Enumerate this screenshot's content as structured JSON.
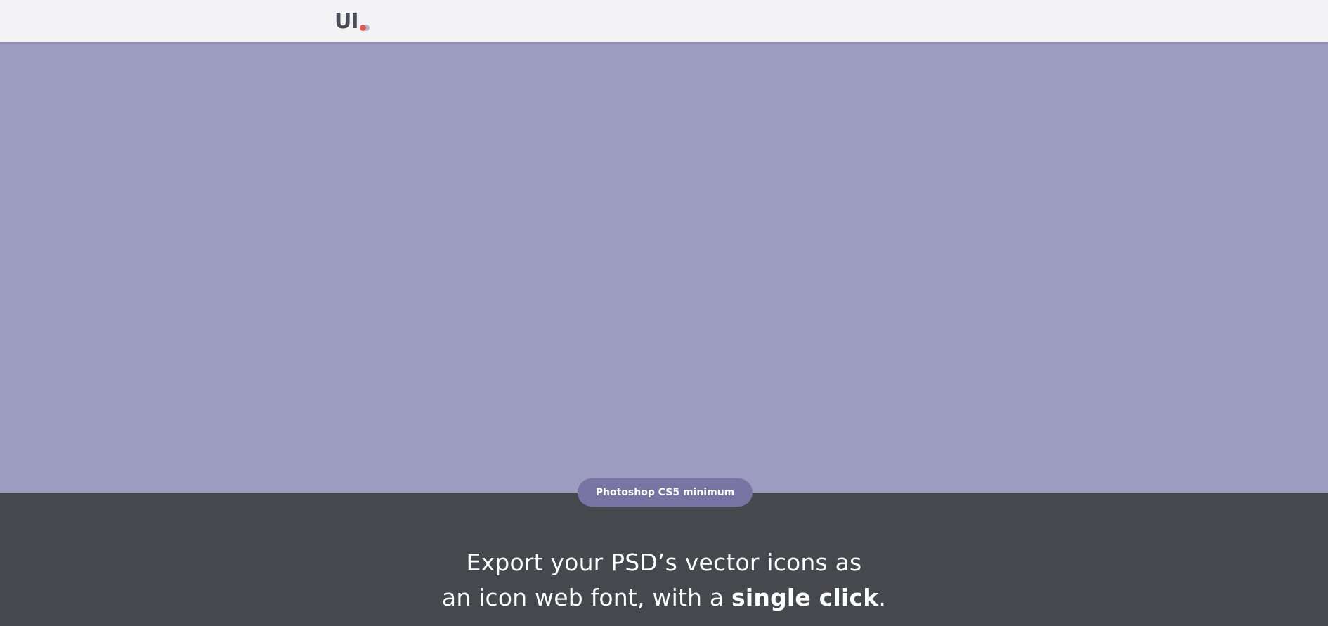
{
  "header": {
    "logo_text": "UI",
    "colors": {
      "background": "#f4f4f7",
      "logo_text": "#4a4d57",
      "dot_front": "#e05a5a",
      "dot_back": "#b9b9c4"
    }
  },
  "hero": {
    "color": "#9c9bc0"
  },
  "badge": {
    "label": "Photoshop CS5 minimum",
    "color": "#7874a3"
  },
  "lower": {
    "color": "#46484e",
    "headline_line1": "Export your PSD’s vector icons as",
    "headline_line2_prefix": "an icon web font, with a ",
    "headline_line2_bold": "single click",
    "headline_line2_suffix": "."
  }
}
